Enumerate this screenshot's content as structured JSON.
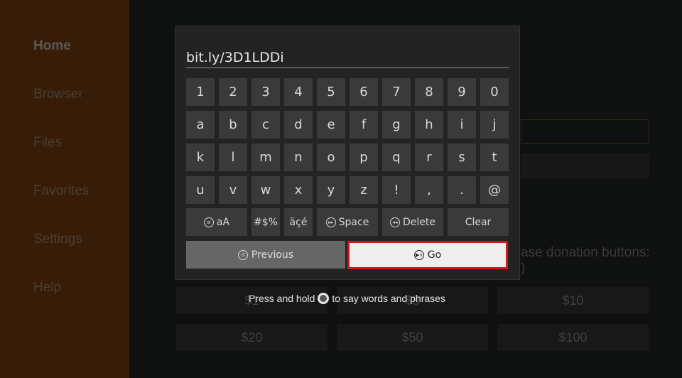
{
  "sidebar": {
    "items": [
      {
        "label": "Home"
      },
      {
        "label": "Browser"
      },
      {
        "label": "Files"
      },
      {
        "label": "Favorites"
      },
      {
        "label": "Settings"
      },
      {
        "label": "Help"
      }
    ]
  },
  "background": {
    "donation_text": "ase donation buttons:",
    "donation_text2": ")",
    "donation_buttons": [
      "$1",
      "$5",
      "$10",
      "$20",
      "$50",
      "$100"
    ]
  },
  "keyboard": {
    "input_value": "bit.ly/3D1LDDi",
    "rows": [
      [
        "1",
        "2",
        "3",
        "4",
        "5",
        "6",
        "7",
        "8",
        "9",
        "0"
      ],
      [
        "a",
        "b",
        "c",
        "d",
        "e",
        "f",
        "g",
        "h",
        "i",
        "j"
      ],
      [
        "k",
        "l",
        "m",
        "n",
        "o",
        "p",
        "q",
        "r",
        "s",
        "t"
      ],
      [
        "u",
        "v",
        "w",
        "x",
        "y",
        "z",
        "!",
        ",",
        ".",
        "@"
      ]
    ],
    "case_label": "aA",
    "symbols_label": "#$%",
    "accents_label": "äçé",
    "space_label": "Space",
    "delete_label": "Delete",
    "clear_label": "Clear",
    "previous_label": "Previous",
    "go_label": "Go",
    "hint_before": "Press and hold",
    "hint_after": "to say words and phrases"
  },
  "colors": {
    "focus_border": "#d3141d",
    "sidebar_bg": "#371d08"
  }
}
